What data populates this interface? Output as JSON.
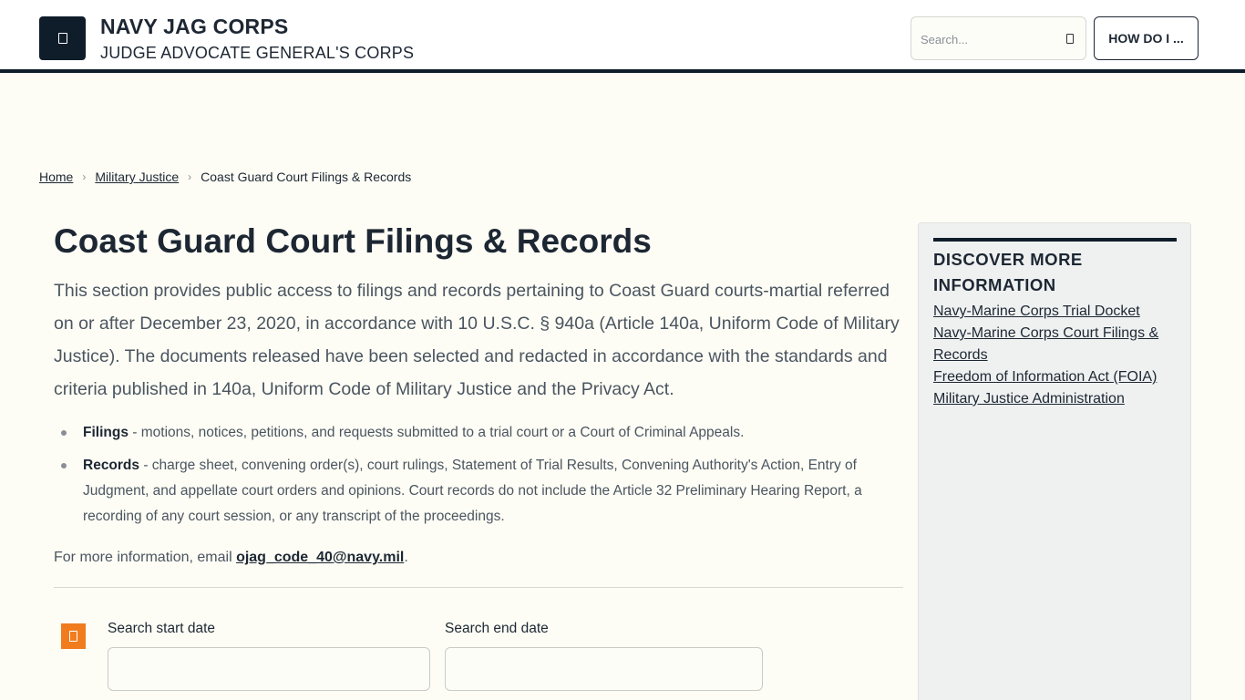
{
  "header": {
    "title": "NAVY JAG CORPS",
    "subtitle": "JUDGE ADVOCATE GENERAL'S CORPS",
    "logo_icon": "shield-icon",
    "search": {
      "placeholder": "Search...",
      "value": "",
      "icon": "search-icon"
    },
    "how_do_i_label": "HOW DO I ..."
  },
  "breadcrumb": {
    "home": "Home",
    "military_justice": "Military Justice",
    "current": "Coast Guard Court Filings & Records",
    "separator": "›"
  },
  "main": {
    "title": "Coast Guard Court Filings & Records",
    "intro": "This section provides public access to filings and records pertaining to Coast Guard courts-martial referred on or after December 23, 2020, in accordance with 10 U.S.C. § 940a (Article 140a, Uniform Code of Military Justice). The documents released have been selected and redacted in accordance with the standards and criteria published in 140a, Uniform Code of Military Justice and the Privacy Act.",
    "bullets": [
      {
        "term": "Filings",
        "text": " - motions, notices, petitions, and requests submitted to a trial court or a Court of Criminal Appeals."
      },
      {
        "term": "Records",
        "text": " - charge sheet, convening order(s), court rulings, Statement of Trial Results, Convening Authority's Action, Entry of Judgment, and appellate court orders and opinions. Court records do not include the Article 32 Preliminary Hearing Report, a recording of any court session, or any transcript of the proceedings."
      }
    ],
    "more_info_prefix": "For more information, email ",
    "more_info_email": "ojag_code_40@navy.mil",
    "more_info_suffix": "."
  },
  "filters": {
    "filter_icon": "filter-icon",
    "start_label": "Search start date",
    "start_value": "",
    "end_label": "Search end date",
    "end_value": ""
  },
  "sidebar": {
    "title": "DISCOVER MORE INFORMATION",
    "links": [
      "Navy-Marine Corps Trial Docket",
      "Navy-Marine Corps Court Filings & Records",
      "Freedom of Information Act (FOIA)",
      "Military Justice Administration"
    ]
  },
  "colors": {
    "navy": "#0f1d2a",
    "background": "#fdfdf5",
    "accent_orange": "#f07c1e",
    "sidebar_bg": "#eff1f1"
  }
}
